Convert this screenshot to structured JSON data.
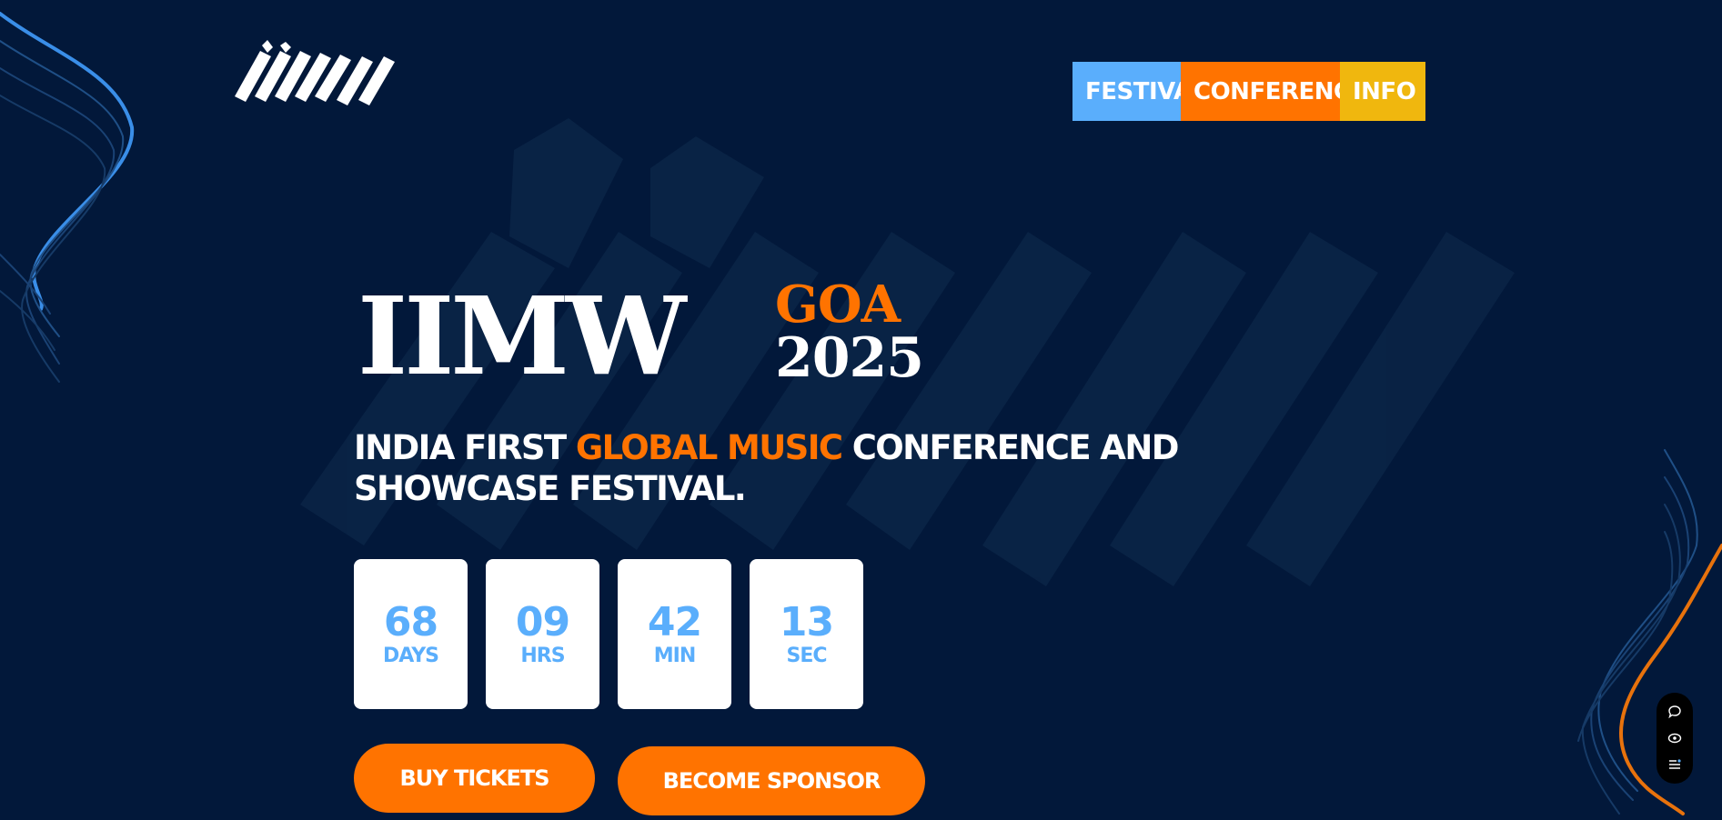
{
  "colors": {
    "background": "#02183a",
    "accent_orange": "#ff7300",
    "accent_blue": "#5aaefc",
    "accent_yellow": "#f0b70e",
    "white": "#ffffff"
  },
  "nav": {
    "tabs": [
      {
        "label": "FESTIVAL",
        "color": "#5aaefc"
      },
      {
        "label": "CONFERENCE",
        "color": "#ff7300"
      },
      {
        "label": "INFO",
        "color": "#f0b70e"
      }
    ]
  },
  "hero": {
    "title": "IIMW",
    "city": "GOA",
    "year": "2025",
    "tagline": {
      "part1": "INDIA FIRST ",
      "highlight": "GLOBAL MUSIC",
      "part2": " CONFERENCE AND SHOWCASE FESTIVAL."
    }
  },
  "countdown": [
    {
      "value": "68",
      "unit": "DAYS"
    },
    {
      "value": "09",
      "unit": "HRS"
    },
    {
      "value": "42",
      "unit": "MIN"
    },
    {
      "value": "13",
      "unit": "SEC"
    }
  ],
  "buttons": {
    "tickets": "BUY TICKETS",
    "sponsor": "BECOME SPONSOR"
  },
  "side_widget": {
    "icons": [
      "chat-icon",
      "eye-icon",
      "menu-list-icon"
    ]
  }
}
